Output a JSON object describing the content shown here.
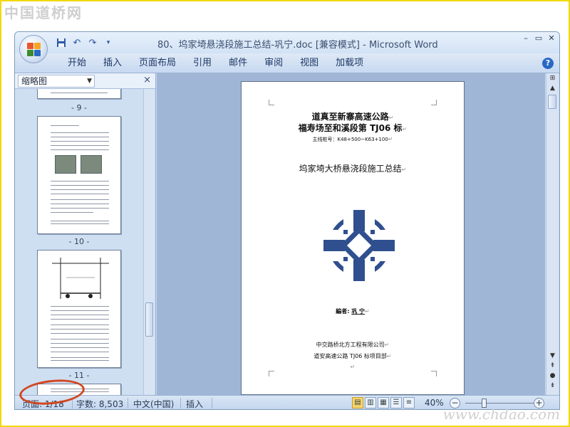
{
  "watermarks": {
    "top": "中国道桥网",
    "bottom": "www.chdao.com"
  },
  "window": {
    "title": "80、坞家埼悬浇段施工总结-巩宁.doc [兼容模式] - Microsoft Word",
    "quick_access": [
      "save-icon",
      "undo-icon",
      "redo-icon",
      "customize-icon"
    ],
    "controls": [
      "minimize",
      "restore",
      "close"
    ]
  },
  "ribbon": {
    "tabs": [
      "开始",
      "插入",
      "页面布局",
      "引用",
      "邮件",
      "审阅",
      "视图",
      "加载项"
    ]
  },
  "thumbnails": {
    "dropdown_label": "缩略图",
    "close_glyph": "×",
    "page_labels": [
      "- 9 -",
      "- 10 -",
      "- 11 -"
    ]
  },
  "document": {
    "line1": "道真至新寨高速公路",
    "line2": "福寿场至和溪段第 TJ06 标",
    "chainage": "主线桩号：K48+500~K63+100",
    "subtitle": "坞家埼大桥悬浇段施工总结",
    "author_label": "編者:",
    "author_name": "巩 宁",
    "company1": "中交路桥北方工程有限公司",
    "company2": "道安高速公路 TJ06 标项目部",
    "return_mark": "↵",
    "para_mark": "↵"
  },
  "statusbar": {
    "page": "页面: 1/18",
    "words": "字数: 8,503",
    "language": "中文(中国)",
    "mode": "插入",
    "zoom": "40%",
    "zoom_level": 0.4
  },
  "colors": {
    "highlight_ellipse": "#d2461f",
    "frame_border": "#f3d800",
    "logo_blue": "#2f4f8f"
  }
}
